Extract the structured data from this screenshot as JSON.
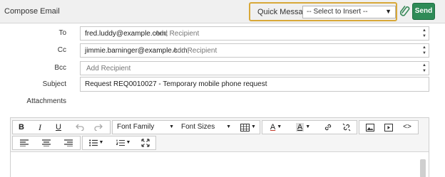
{
  "header": {
    "title": "Compose Email",
    "quick_messages_label": "Quick Messages",
    "quick_messages_select": "-- Select to Insert --",
    "send_label": "Send"
  },
  "form": {
    "to": {
      "label": "To",
      "recipients": [
        "fred.luddy@example.com;"
      ],
      "placeholder": "Add Recipient"
    },
    "cc": {
      "label": "Cc",
      "recipients": [
        "jimmie.barninger@example.com;"
      ],
      "placeholder": "Add Recipient"
    },
    "bcc": {
      "label": "Bcc",
      "recipients": [],
      "placeholder": "Add Recipient"
    },
    "subject": {
      "label": "Subject",
      "value": "Request REQ0010027 - Temporary mobile phone request"
    },
    "attachments": {
      "label": "Attachments"
    }
  },
  "editor": {
    "toolbar": {
      "bold": "B",
      "italic": "I",
      "underline": "U",
      "font_family": "Font Family",
      "font_sizes": "Font Sizes",
      "text_color": "A",
      "bg_color": "A",
      "source_code": "<>"
    },
    "icons": [
      "undo-icon",
      "redo-icon",
      "table-icon",
      "link-icon",
      "unlink-icon",
      "image-icon",
      "video-icon",
      "align-left-icon",
      "align-center-icon",
      "align-right-icon",
      "bullet-list-icon",
      "numbered-list-icon",
      "fullscreen-icon"
    ]
  },
  "colors": {
    "send_button": "#2e8b57",
    "quick_messages_highlight": "#d8a838",
    "header_bg": "#f0f0f0"
  }
}
